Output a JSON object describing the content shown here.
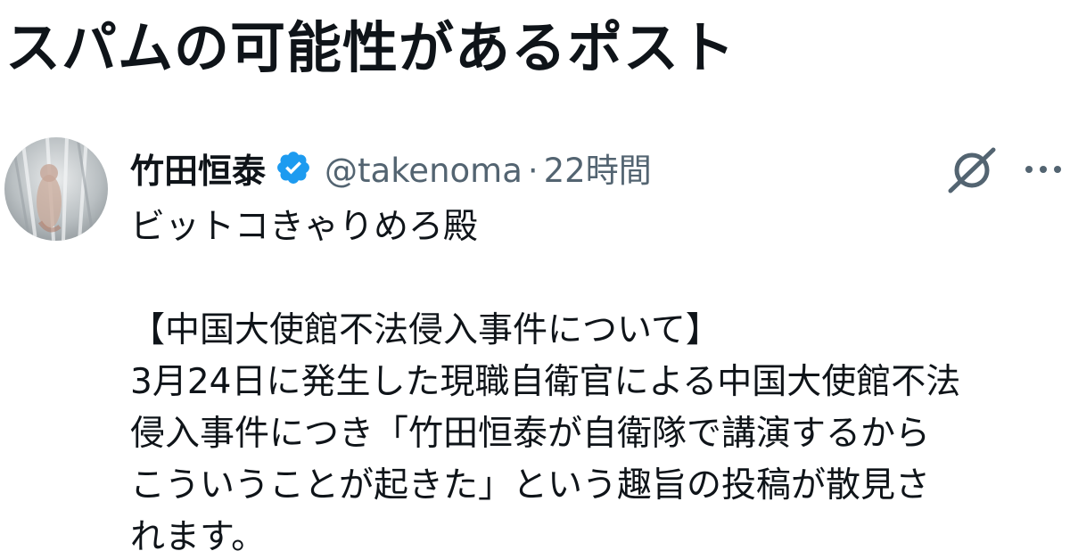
{
  "page_title": "スパムの可能性があるポスト",
  "post": {
    "author": {
      "display_name": "竹田恒泰",
      "handle": "@takenoma",
      "verified": true,
      "avatar": "profile-photo"
    },
    "separator": "·",
    "time_ago": "22時間",
    "icons": {
      "verified": "verified-badge-icon",
      "grok": "grok-icon",
      "more": "more-options-icon"
    },
    "body_lines": [
      "ビットコきゃりめろ殿",
      "",
      "【中国大使館不法侵入事件について】",
      "3月24日に発生した現職自衛官による中国大使館不法",
      "侵入事件につき「竹田恒泰が自衛隊で講演するから",
      "こういうことが起きた」という趣旨の投稿が散見さ",
      "れます。"
    ]
  },
  "colors": {
    "text_primary": "#0f1419",
    "text_secondary": "#536471",
    "verified_blue": "#1d9bf0"
  }
}
